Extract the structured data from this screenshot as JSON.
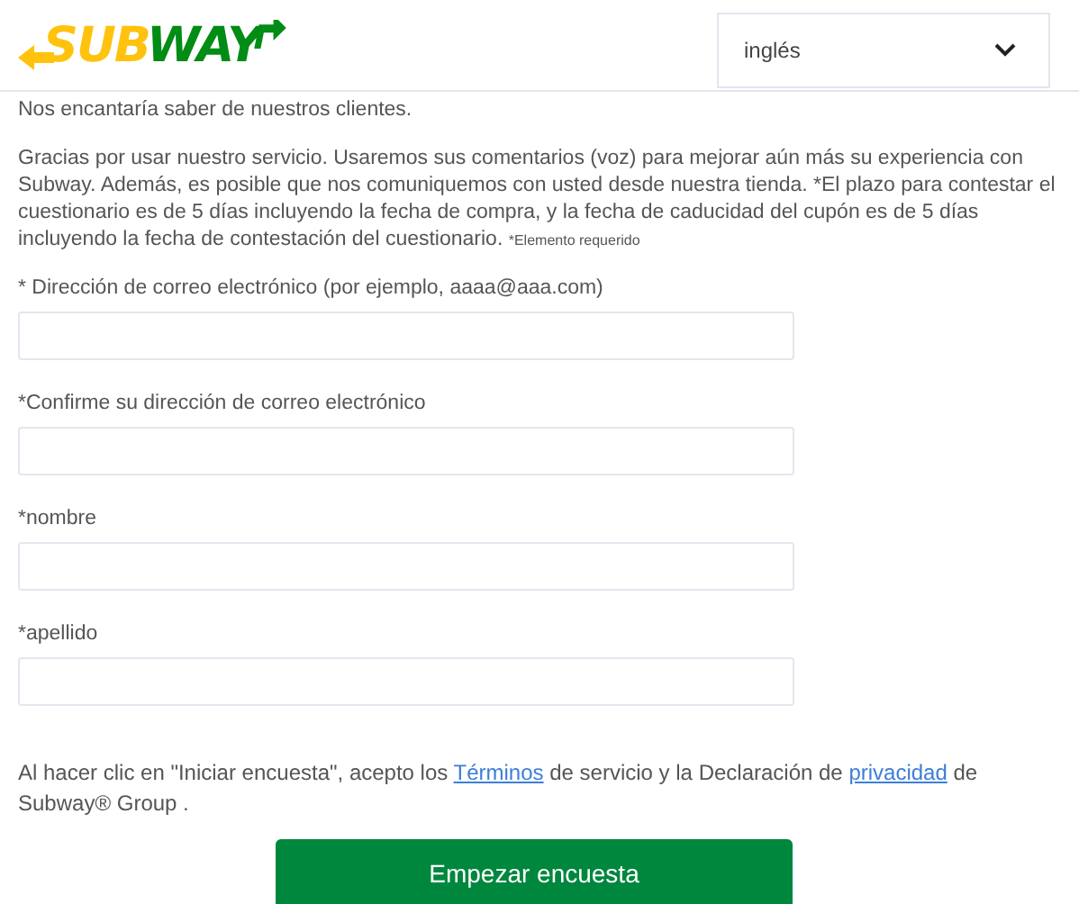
{
  "header": {
    "logo": {
      "part_1": "SUB",
      "part_2": "WAY"
    },
    "language_select": {
      "value": "inglés"
    }
  },
  "intro": "Nos encantaría saber de nuestros clientes.",
  "description": "Gracias por usar nuestro servicio. Usaremos sus comentarios (voz) para mejorar aún más su experiencia con Subway. Además, es posible que nos comuniquemos con usted desde nuestra tienda. *El plazo para contestar el cuestionario es de 5 días incluyendo la fecha de compra, y la fecha de caducidad del cupón es de 5 días incluyendo la fecha de contestación del cuestionario.",
  "required_note": "*Elemento requerido",
  "fields": [
    {
      "label": "* Dirección de correo electrónico (por ejemplo, aaaa@aaa.com)"
    },
    {
      "label": "*Confirme su dirección de correo electrónico"
    },
    {
      "label": "*nombre"
    },
    {
      "label": "*apellido"
    }
  ],
  "consent": [
    {
      "kind": "text",
      "text": "Al hacer clic en \"Iniciar encuesta\", acepto los "
    },
    {
      "kind": "link",
      "text": "Términos"
    },
    {
      "kind": "text",
      "text": " de servicio y la Declaración de "
    },
    {
      "kind": "link",
      "text": "privacidad"
    },
    {
      "kind": "text",
      "text": " de Subway® Group ."
    }
  ],
  "submit_button": "Empezar encuesta"
}
